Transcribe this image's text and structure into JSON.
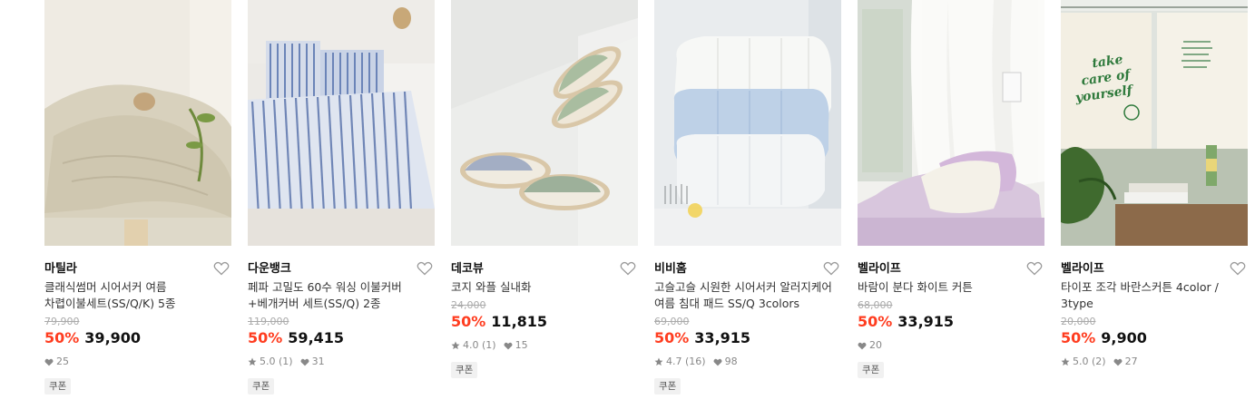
{
  "products": [
    {
      "brand": "마틸라",
      "name": "클래식썸머 시어서커 여름 차렵이불세트(SS/Q/K) 5종",
      "original_price": "79,900",
      "discount": "50%",
      "sale_price": "39,900",
      "rating": "",
      "likes": "25",
      "coupon": "쿠폰"
    },
    {
      "brand": "다운뱅크",
      "name": "페파 고밀도 60수 워싱 이불커버+베개커버 세트(SS/Q) 2종",
      "original_price": "119,000",
      "discount": "50%",
      "sale_price": "59,415",
      "rating": "5.0 (1)",
      "likes": "31",
      "coupon": "쿠폰"
    },
    {
      "brand": "데코뷰",
      "name": "코지 와플 실내화",
      "original_price": "24,000",
      "discount": "50%",
      "sale_price": "11,815",
      "rating": "4.0 (1)",
      "likes": "15",
      "coupon": "쿠폰"
    },
    {
      "brand": "비비홈",
      "name": "고슬고슬 시원한 시어서커 알러지케어 여름 침대 패드 SS/Q 3colors",
      "original_price": "69,000",
      "discount": "50%",
      "sale_price": "33,915",
      "rating": "4.7 (16)",
      "likes": "98",
      "coupon": "쿠폰"
    },
    {
      "brand": "벨라이프",
      "name": "바람이 분다 화이트 커튼",
      "original_price": "68,000",
      "discount": "50%",
      "sale_price": "33,915",
      "rating": "",
      "likes": "20",
      "coupon": "쿠폰"
    },
    {
      "brand": "벨라이프",
      "name": "타이포 조각 바란스커튼 4color / 3type",
      "original_price": "20,000",
      "discount": "50%",
      "sale_price": "9,900",
      "rating": "5.0 (2)",
      "likes": "27",
      "coupon": ""
    }
  ],
  "image_text": {
    "bag_line1": "take",
    "bag_line2": "care of",
    "bag_line3": "yourself"
  },
  "colors": {
    "discount": "#ff3d20",
    "text": "#222222",
    "muted": "#888888"
  }
}
